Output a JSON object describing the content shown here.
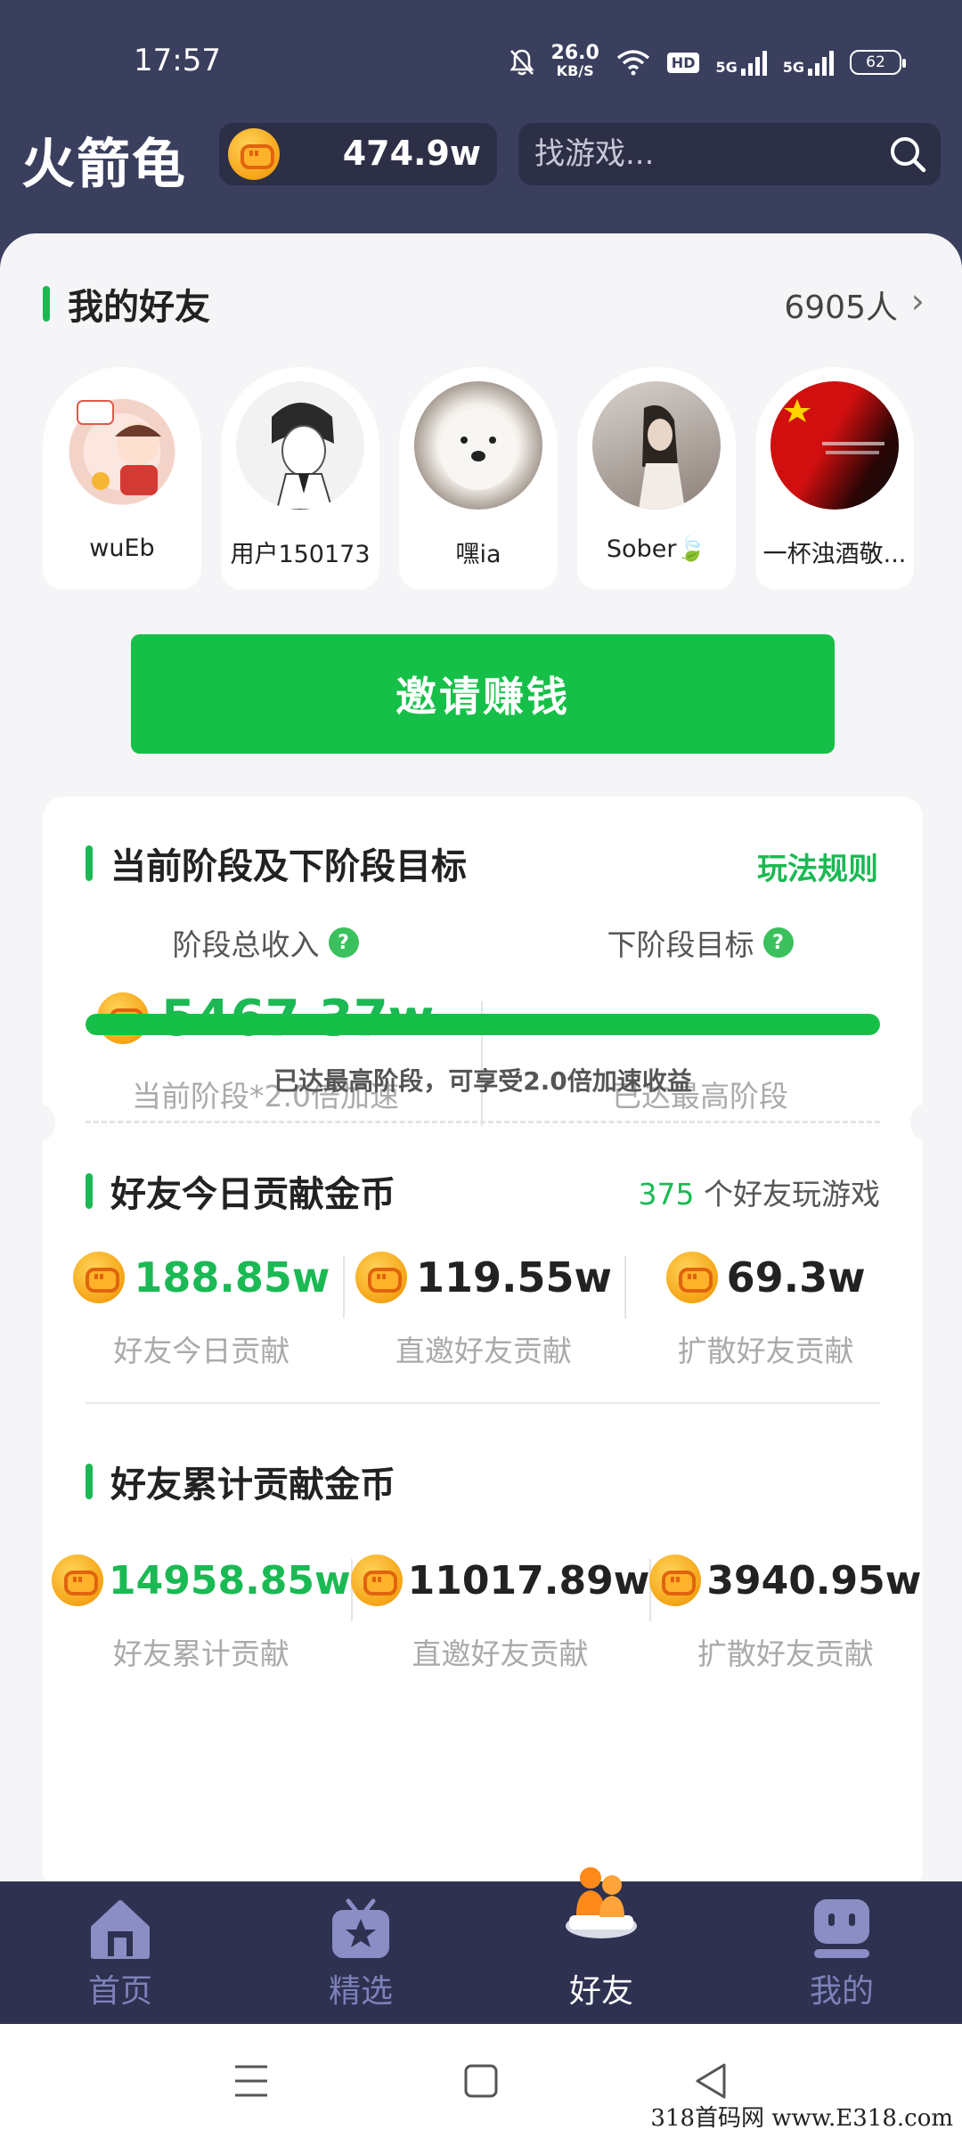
{
  "status_bar": {
    "time": "17:57",
    "net_speed_value": "26.0",
    "net_speed_unit": "KB/S",
    "hd_label": "HD",
    "signal_1": "5G",
    "signal_2": "5G",
    "battery": "62"
  },
  "header": {
    "app_name": "火箭龟",
    "coin_balance": "474.9w",
    "search_placeholder": "找游戏..."
  },
  "friends": {
    "title": "我的好友",
    "count": "6905人",
    "items": [
      {
        "name": "wuEb"
      },
      {
        "name": "用户150173"
      },
      {
        "name": "嘿ia"
      },
      {
        "name": "Sober🍃"
      },
      {
        "name": "一杯浊酒敬..."
      }
    ]
  },
  "invite_button": "邀请赚钱",
  "stage": {
    "title": "当前阶段及下阶段目标",
    "rules_link": "玩法规则",
    "left_label": "阶段总收入",
    "left_value": "5467.37w",
    "left_sub": "当前阶段*2.0倍加速",
    "right_label": "下阶段目标",
    "right_value": "--",
    "right_sub": "已达最高阶段",
    "question_mark": "?",
    "progress_percent": 100,
    "progress_note": "已达最高阶段，可享受2.0倍加速收益"
  },
  "today": {
    "title": "好友今日贡献金币",
    "playing_count": "375",
    "playing_suffix": " 个好友玩游戏",
    "cells": [
      {
        "value": "188.85w",
        "label": "好友今日贡献"
      },
      {
        "value": "119.55w",
        "label": "直邀好友贡献"
      },
      {
        "value": "69.3w",
        "label": "扩散好友贡献"
      }
    ]
  },
  "total": {
    "title": "好友累计贡献金币",
    "cells": [
      {
        "value": "14958.85w",
        "label": "好友累计贡献"
      },
      {
        "value": "11017.89w",
        "label": "直邀好友贡献"
      },
      {
        "value": "3940.95w",
        "label": "扩散好友贡献"
      }
    ]
  },
  "bottom_nav": [
    {
      "label": "首页",
      "icon": "home-icon",
      "active": false
    },
    {
      "label": "精选",
      "icon": "star-gift-icon",
      "active": false
    },
    {
      "label": "好友",
      "icon": "friends-icon",
      "active": true
    },
    {
      "label": "我的",
      "icon": "profile-icon",
      "active": false
    }
  ],
  "watermark": "318首码网 www.E318.com",
  "colors": {
    "brand_green": "#16c048",
    "header_bg": "#3b3f5e",
    "nav_bg": "#2e3150",
    "nav_inactive": "#7d81b8"
  }
}
